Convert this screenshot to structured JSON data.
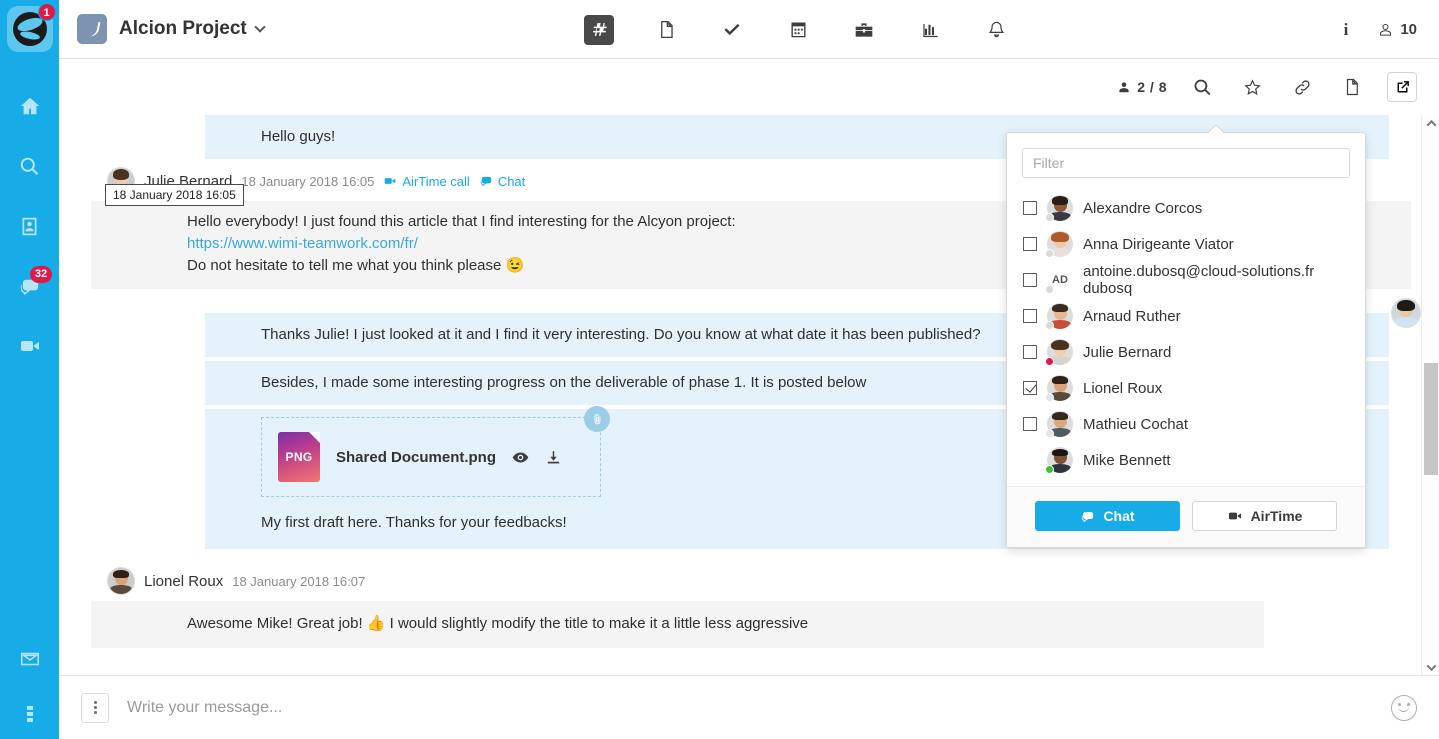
{
  "app": {
    "logo_badge": "1",
    "rail_items": [
      {
        "name": "home",
        "badge": ""
      },
      {
        "name": "search",
        "badge": ""
      },
      {
        "name": "contacts",
        "badge": ""
      },
      {
        "name": "chat",
        "badge": "32"
      },
      {
        "name": "airtime-video",
        "badge": ""
      },
      {
        "name": "mail",
        "badge": ""
      },
      {
        "name": "more-options",
        "badge": ""
      }
    ]
  },
  "topbar": {
    "project_title": "Alcion Project",
    "nav": [
      {
        "icon": "hash-icon",
        "label": "Channels",
        "active": true
      },
      {
        "icon": "document-icon",
        "label": "Documents",
        "active": false
      },
      {
        "icon": "check-icon",
        "label": "Tasks",
        "active": false
      },
      {
        "icon": "calendar-icon",
        "label": "Calendar",
        "active": false
      },
      {
        "icon": "briefcase-icon",
        "label": "Workspace",
        "active": false
      },
      {
        "icon": "chart-icon",
        "label": "Reports",
        "active": false
      },
      {
        "icon": "bell-icon",
        "label": "Notifications",
        "active": false
      }
    ],
    "info_label": "i",
    "member_count": "10"
  },
  "subbar": {
    "participants": "2 / 8",
    "buttons": [
      {
        "icon": "search-icon",
        "label": "Search"
      },
      {
        "icon": "star-icon",
        "label": "Favorite"
      },
      {
        "icon": "link-icon",
        "label": "Link"
      },
      {
        "icon": "document-icon",
        "label": "Document"
      },
      {
        "icon": "external-link-icon",
        "label": "Open in new window",
        "active": true
      }
    ]
  },
  "chat": {
    "messages": [
      {
        "type": "bubble",
        "text": "Hello guys!"
      },
      {
        "type": "author-block",
        "author": "Julie Bernard",
        "time": "18 January 2018 16:05",
        "tooltip": "18 January 2018 16:05",
        "actions": [
          {
            "icon": "video-icon",
            "label": "AirTime call"
          },
          {
            "icon": "chat-icon",
            "label": "Chat"
          }
        ],
        "lines": [
          {
            "kind": "text",
            "text": "Hello everybody! I just found this article that I find interesting for the Alcyon project:"
          },
          {
            "kind": "link",
            "text": "https://www.wimi-teamwork.com/fr/"
          },
          {
            "kind": "text",
            "text": "Do not hesitate to tell me what you think please 😉"
          }
        ]
      },
      {
        "type": "bubble",
        "text": "Thanks Julie! I just looked at it and I find it very interesting. Do you know at what date it has been published?"
      },
      {
        "type": "bubble",
        "text": "Besides, I made some interesting progress on the deliverable of phase 1. It is posted below"
      },
      {
        "type": "attachment",
        "starred": true,
        "file_name": "Shared Document.png",
        "file_type": "PNG",
        "caption": "My first draft here. Thanks for your feedbacks!",
        "actions": [
          {
            "icon": "eye-icon",
            "label": "Preview"
          },
          {
            "icon": "download-icon",
            "label": "Download"
          }
        ]
      },
      {
        "type": "author-block",
        "author": "Lionel Roux",
        "time": "18 January 2018 16:07",
        "tooltip": "",
        "actions": [],
        "lines": [
          {
            "kind": "text",
            "text": "Awesome Mike!  Great job! 👍 I would slightly modify the title to make it a little less aggressive"
          }
        ]
      }
    ]
  },
  "composer": {
    "more_label": "More options",
    "placeholder": "Write your message...",
    "emoji_label": "Emoji picker"
  },
  "popup": {
    "filter_placeholder": "Filter",
    "members": [
      {
        "name": "Alexandre Corcos",
        "checked": false,
        "has_checkbox": true,
        "status": "offline",
        "avatar": "photo",
        "skin": "#8a5a3c",
        "hair": "#2b1d14",
        "shirt": "#3a3a42",
        "initials": ""
      },
      {
        "name": "Anna Dirigeante Viator",
        "checked": false,
        "has_checkbox": true,
        "status": "offline",
        "avatar": "photo",
        "skin": "#f0c8a8",
        "hair": "#b05a2a",
        "shirt": "#e8e0da",
        "initials": ""
      },
      {
        "name": "antoine.dubosq@cloud-solutions.fr dubosq",
        "checked": false,
        "has_checkbox": true,
        "status": "offline",
        "avatar": "initials",
        "skin": "",
        "hair": "",
        "shirt": "",
        "initials": "AD"
      },
      {
        "name": "Arnaud Ruther",
        "checked": false,
        "has_checkbox": true,
        "status": "offline",
        "avatar": "photo",
        "skin": "#e8b693",
        "hair": "#3b2a1c",
        "shirt": "#c94e3a",
        "initials": ""
      },
      {
        "name": "Julie Bernard",
        "checked": false,
        "has_checkbox": true,
        "status": "busy",
        "avatar": "photo",
        "skin": "#f1cdb0",
        "hair": "#4a3222",
        "shirt": "#d8d2cc",
        "initials": ""
      },
      {
        "name": "Lionel Roux",
        "checked": true,
        "has_checkbox": true,
        "status": "offline",
        "avatar": "photo",
        "skin": "#d9a378",
        "hair": "#2e2216",
        "shirt": "#5a4a3a",
        "initials": ""
      },
      {
        "name": "Mathieu Cochat",
        "checked": false,
        "has_checkbox": true,
        "status": "offline",
        "avatar": "photo",
        "skin": "#dba77f",
        "hair": "#33281c",
        "shirt": "#4f5b63",
        "initials": ""
      },
      {
        "name": "Mike Bennett",
        "checked": false,
        "has_checkbox": false,
        "status": "online",
        "avatar": "photo",
        "skin": "#7a5235",
        "hair": "#1d1610",
        "shirt": "#2f3640",
        "initials": ""
      }
    ],
    "actions": {
      "chat_label": "Chat",
      "airtime_label": "AirTime"
    }
  },
  "colors": {
    "brand": "#17ACE8",
    "bubble": "#E4F2FB",
    "grey_block": "#F4F4F4",
    "badge": "#E0194B",
    "link": "#39A9DC",
    "star": "#F7C325",
    "online": "#3FC23F",
    "busy": "#E0194B"
  }
}
